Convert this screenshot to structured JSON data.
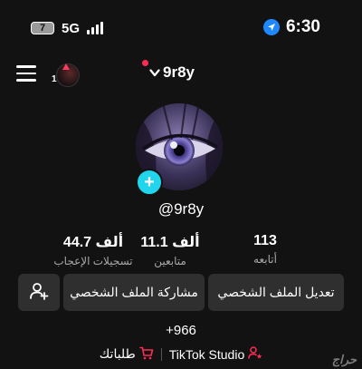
{
  "status_bar": {
    "battery": "7",
    "network": "5G",
    "time": "6:30"
  },
  "header": {
    "username": "9r8y",
    "story_count": "1"
  },
  "profile": {
    "handle": "@9r8y",
    "add_symbol": "+"
  },
  "stats": {
    "following": {
      "value": "113",
      "label": "أتابعه"
    },
    "followers": {
      "value": "11.1 ألف",
      "label": "متابعين"
    },
    "likes": {
      "value": "44.7 ألف",
      "label": "تسجيلات الإعجاب"
    }
  },
  "actions": {
    "edit_profile": "تعديل الملف الشخصي",
    "share_profile": "مشاركة الملف الشخصي"
  },
  "bio": {
    "phone": "+966"
  },
  "links": {
    "studio": "TikTok Studio",
    "orders": "طلباتك"
  },
  "watermark": "حراج",
  "colors": {
    "background": "#121212",
    "button": "#2f2f2f",
    "accent_cyan": "#20d5ec",
    "accent_red": "#ff2b55",
    "location_blue": "#1e88ff"
  }
}
